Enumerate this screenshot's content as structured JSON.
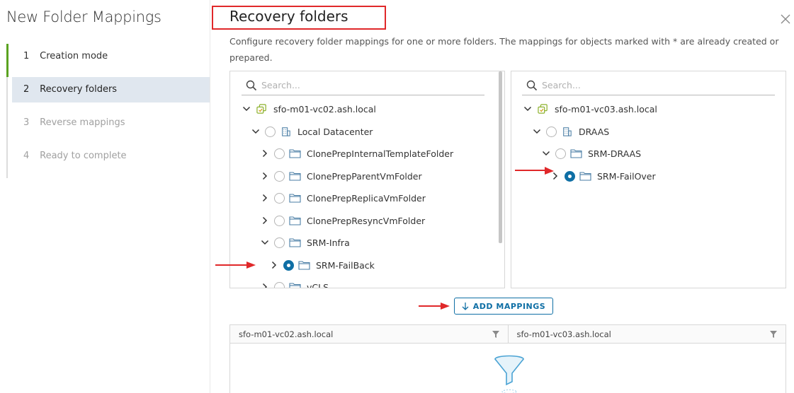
{
  "wizard": {
    "title": "New Folder Mappings",
    "steps": [
      {
        "num": "1",
        "label": "Creation mode",
        "state": "done"
      },
      {
        "num": "2",
        "label": "Recovery folders",
        "state": "active"
      },
      {
        "num": "3",
        "label": "Reverse mappings",
        "state": "disabled"
      },
      {
        "num": "4",
        "label": "Ready to complete",
        "state": "disabled"
      }
    ]
  },
  "page": {
    "title": "Recovery folders",
    "description": "Configure recovery folder mappings for one or more folders. The mappings for objects marked with * are already created or prepared."
  },
  "left_tree": {
    "search_placeholder": "Search...",
    "root": "sfo-m01-vc02.ash.local",
    "datacenter": "Local Datacenter",
    "folders": [
      "ClonePrepInternalTemplateFolder",
      "ClonePrepParentVmFolder",
      "ClonePrepReplicaVmFolder",
      "ClonePrepResyncVmFolder",
      "SRM-Infra",
      "SRM-FailBack",
      "vCLS"
    ]
  },
  "right_tree": {
    "search_placeholder": "Search...",
    "root": "sfo-m01-vc03.ash.local",
    "datacenter": "DRAAS",
    "folders": [
      "SRM-DRAAS",
      "SRM-FailOver"
    ]
  },
  "actions": {
    "add_mappings": "ADD MAPPINGS"
  },
  "grid": {
    "columns": [
      "sfo-m01-vc02.ash.local",
      "sfo-m01-vc03.ash.local"
    ]
  },
  "colors": {
    "accent": "#0f6fa5",
    "annotation_red": "#e0282a",
    "done_green": "#5aa220"
  }
}
